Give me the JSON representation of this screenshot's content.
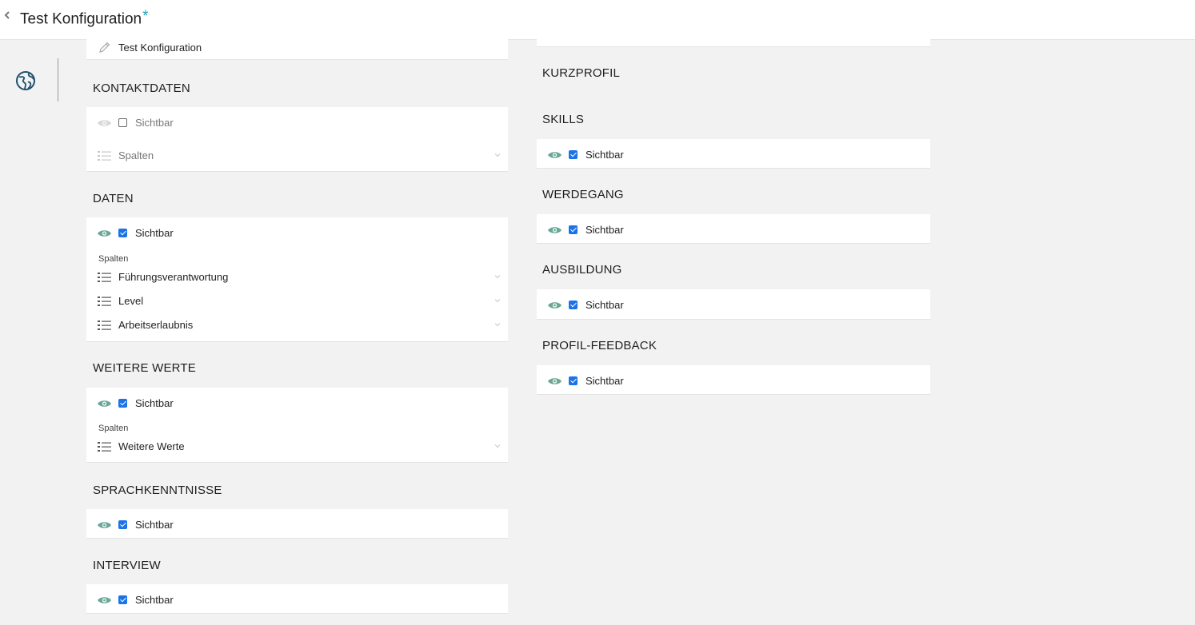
{
  "header": {
    "title": "Test Konfiguration",
    "modified_marker": "*"
  },
  "sidebar": {
    "icons": [
      "globe-icon"
    ]
  },
  "name_field": {
    "value": "Test Konfiguration"
  },
  "colors": {
    "accent": "#1ba3b9",
    "eye_active": "#6aa797",
    "eye_inactive": "#cfcfcf",
    "checkbox": "#1a73e8"
  },
  "sections": {
    "kontaktdaten": {
      "title": "KONTAKTDATEN",
      "visible_label": "Sichtbar",
      "visible": false,
      "columns_placeholder": "Spalten"
    },
    "daten": {
      "title": "DATEN",
      "visible_label": "Sichtbar",
      "visible": true,
      "columns_label": "Spalten",
      "columns": [
        "Führungsverantwortung",
        "Level",
        "Arbeitserlaubnis"
      ]
    },
    "weitere_werte": {
      "title": "WEITERE WERTE",
      "visible_label": "Sichtbar",
      "visible": true,
      "columns_label": "Spalten",
      "columns": [
        "Weitere Werte"
      ]
    },
    "sprachkenntnisse": {
      "title": "SPRACHKENNTNISSE",
      "visible_label": "Sichtbar",
      "visible": true
    },
    "interview": {
      "title": "INTERVIEW",
      "visible_label": "Sichtbar",
      "visible": true
    },
    "kurzprofil": {
      "title": "KURZPROFIL"
    },
    "skills": {
      "title": "SKILLS",
      "visible_label": "Sichtbar",
      "visible": true
    },
    "werdegang": {
      "title": "WERDEGANG",
      "visible_label": "Sichtbar",
      "visible": true
    },
    "ausbildung": {
      "title": "AUSBILDUNG",
      "visible_label": "Sichtbar",
      "visible": true
    },
    "profil_feedback": {
      "title": "PROFIL-FEEDBACK",
      "visible_label": "Sichtbar",
      "visible": true
    }
  }
}
